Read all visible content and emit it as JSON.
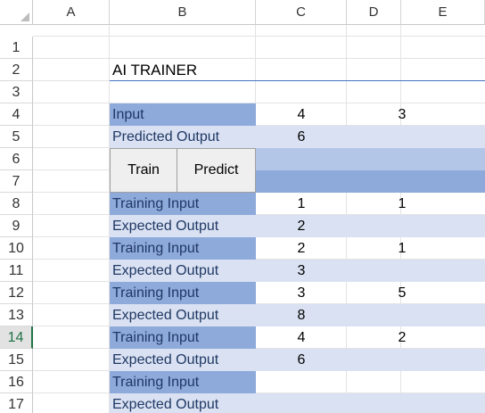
{
  "columns": [
    "A",
    "B",
    "C",
    "D",
    "E"
  ],
  "rows": [
    "1",
    "2",
    "3",
    "4",
    "5",
    "6",
    "7",
    "8",
    "9",
    "10",
    "11",
    "12",
    "13",
    "14",
    "15",
    "16",
    "17"
  ],
  "selected_row": "14",
  "title": "AI TRAINER",
  "buttons": {
    "train": "Train",
    "predict": "Predict"
  },
  "input": {
    "label": "Input",
    "c": "4",
    "d": "3"
  },
  "predicted": {
    "label": "Predicted Output",
    "c": "6"
  },
  "training": [
    {
      "input_label": "Training Input",
      "c": "1",
      "d": "1",
      "expected_label": "Expected Output",
      "expected": "2"
    },
    {
      "input_label": "Training Input",
      "c": "2",
      "d": "1",
      "expected_label": "Expected Output",
      "expected": "3"
    },
    {
      "input_label": "Training Input",
      "c": "3",
      "d": "5",
      "expected_label": "Expected Output",
      "expected": "8"
    },
    {
      "input_label": "Training Input",
      "c": "4",
      "d": "2",
      "expected_label": "Expected Output",
      "expected": "6"
    },
    {
      "input_label": "Training Input",
      "c": "",
      "d": "",
      "expected_label": "Expected Output",
      "expected": ""
    }
  ],
  "colors": {
    "dark_band": "#8eaadb",
    "light_band": "#d9e1f2",
    "mid_band": "#b4c6e7",
    "accent": "#4472c4",
    "selection": "#217346"
  }
}
